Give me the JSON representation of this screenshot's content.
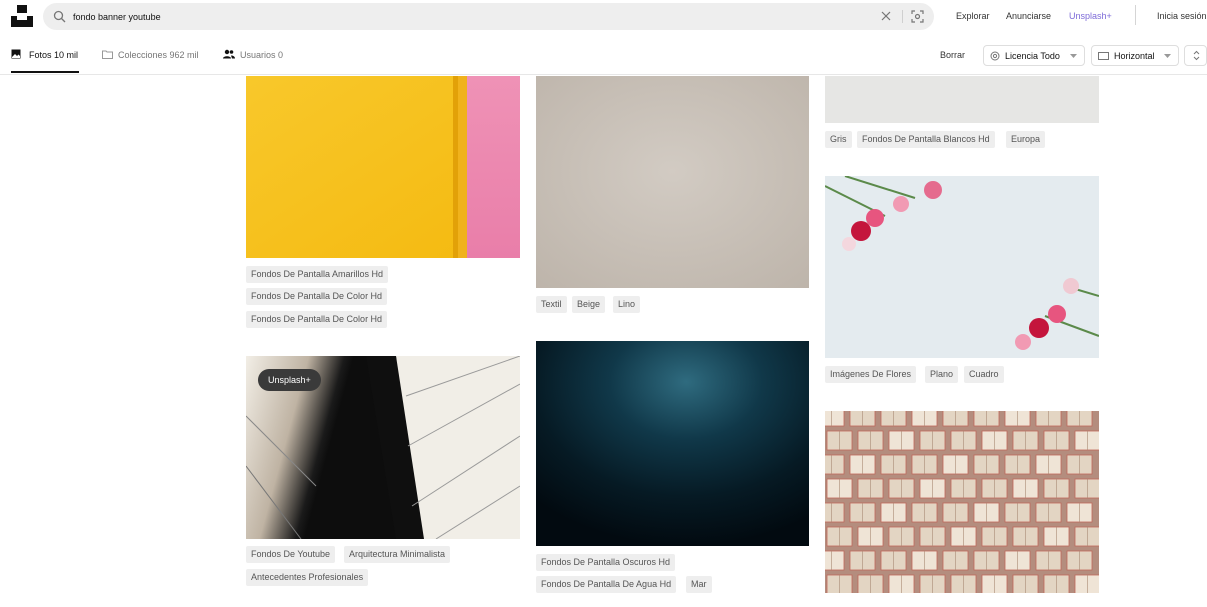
{
  "header": {
    "search_value": "fondo banner youtube",
    "nav": {
      "explore": "Explorar",
      "advertise": "Anunciarse",
      "plus": "Unsplash+",
      "login": "Inicia sesión"
    }
  },
  "tabs": {
    "photos": "Fotos 10 mil",
    "collections": "Colecciones 962 mil",
    "users": "Usuarios 0"
  },
  "filters": {
    "clear": "Borrar",
    "license": "Licencia Todo",
    "orientation": "Horizontal"
  },
  "photos": [
    {
      "id": "yellow-wall",
      "tags": [
        "Fondos De Pantalla Amarillos Hd",
        "Fondos De Pantalla De Color Hd",
        "Fondos De Pantalla De Color Hd"
      ]
    },
    {
      "id": "architecture",
      "badge": "Unsplash+",
      "tags": [
        "Fondos De Youtube",
        "Arquitectura Minimalista",
        "Antecedentes Profesionales"
      ]
    },
    {
      "id": "linen",
      "tags": [
        "Textil",
        "Beige",
        "Lino"
      ]
    },
    {
      "id": "dark-water",
      "tags": [
        "Fondos De Pantalla Oscuros Hd",
        "Fondos De Pantalla De Agua Hd",
        "Mar"
      ]
    },
    {
      "id": "white-texture",
      "tags": [
        "Gris",
        "Fondos De Pantalla Blancos Hd",
        "Europa"
      ]
    },
    {
      "id": "flowers",
      "tags": [
        "Imágenes De Flores",
        "Plano",
        "Cuadro"
      ]
    },
    {
      "id": "books"
    }
  ],
  "colors": {
    "accent_plus": "#7d6bd8",
    "tag_bg": "#eeeeee",
    "search_bg": "#eeeeee"
  }
}
